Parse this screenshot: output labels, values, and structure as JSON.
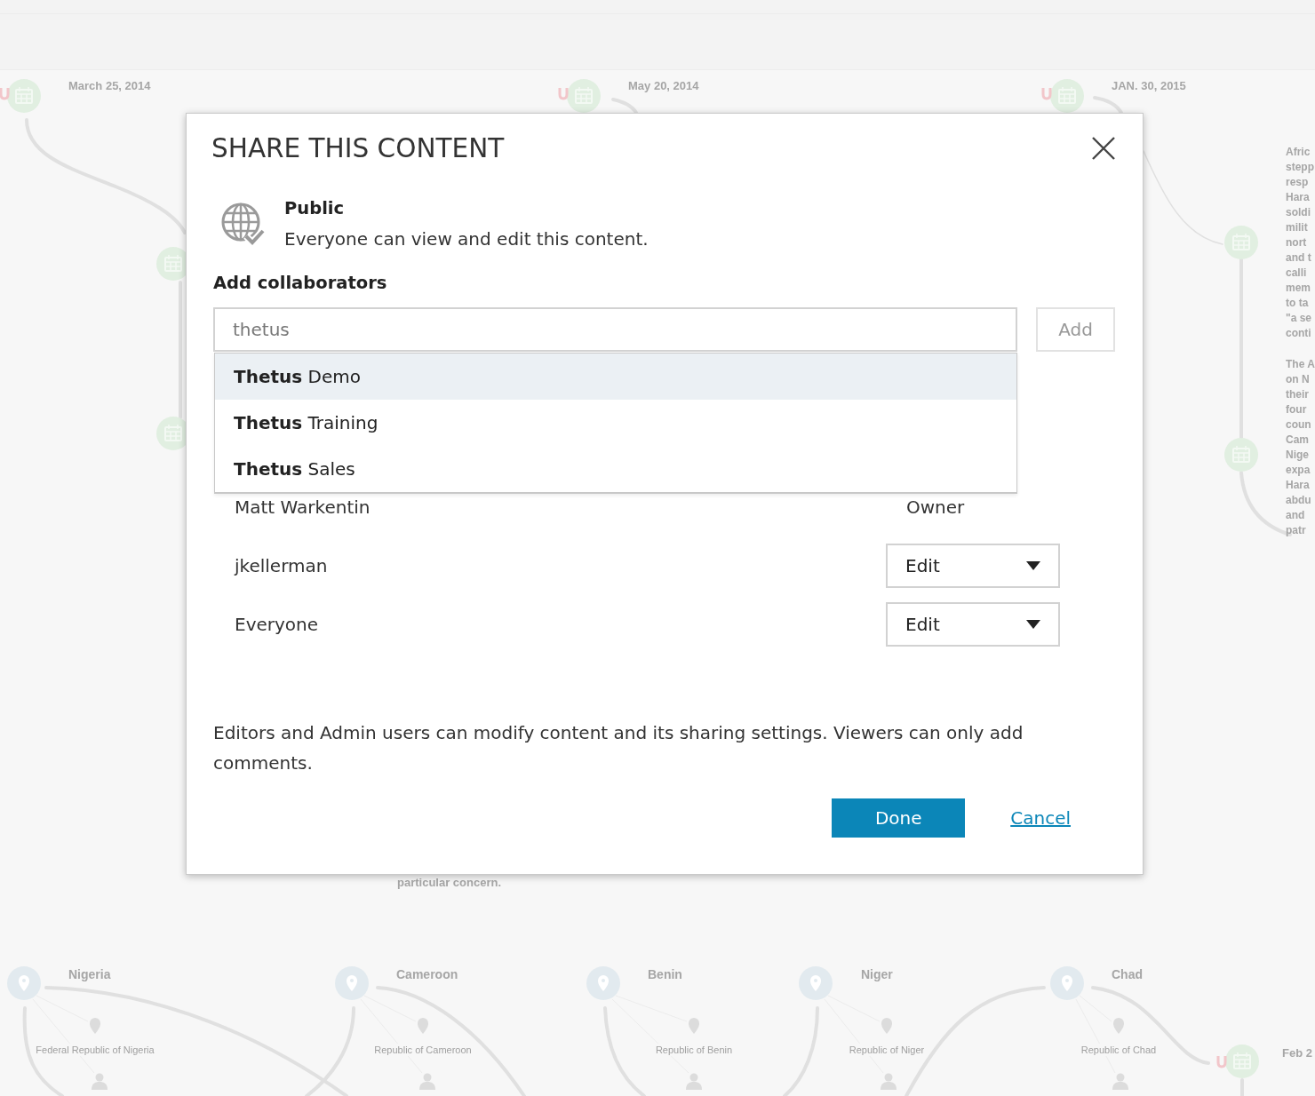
{
  "background": {
    "timeline_dates": [
      "March 25, 2014",
      "May 20, 2014",
      "JAN. 30, 2015",
      "Feb 2"
    ],
    "side_text": [
      [
        "Afric",
        "stepp",
        "resp",
        "Hara",
        "soldi",
        "milit",
        "nort",
        "and t",
        "calli",
        "mem",
        "to ta",
        "\"a se",
        "conti"
      ],
      [
        "The A",
        "on N",
        "their",
        "four",
        "coun",
        "Cam",
        "Nige",
        "expa",
        "Hara",
        "abdu",
        "and",
        "patr"
      ]
    ],
    "caption_fragment": "particular concern.",
    "locations": [
      {
        "name": "Nigeria",
        "detail": "Federal Republic of Nigeria"
      },
      {
        "name": "Cameroon",
        "detail": "Republic of Cameroon"
      },
      {
        "name": "Benin",
        "detail": "Republic of Benin"
      },
      {
        "name": "Niger",
        "detail": "Republic of Niger"
      },
      {
        "name": "Chad",
        "detail": "Republic of Chad"
      }
    ]
  },
  "dialog": {
    "title": "SHARE THIS CONTENT",
    "visibility": {
      "label": "Public",
      "description": "Everyone can view and edit this content."
    },
    "collaborators_heading": "Add collaborators",
    "search": {
      "value": "thetus"
    },
    "add_button": "Add",
    "suggestions": [
      {
        "label": "**Thetus** Demo",
        "selected": true
      },
      {
        "label": "**Thetus** Training",
        "selected": false
      },
      {
        "label": "**Thetus** Sales",
        "selected": false
      }
    ],
    "collaborators": [
      {
        "name": "Matt Warkentin",
        "kind": "fixed",
        "role": "Owner"
      },
      {
        "name": "jkellerman",
        "kind": "select",
        "role": "Edit"
      },
      {
        "name": "Everyone",
        "kind": "select",
        "role": "Edit"
      }
    ],
    "note": "Editors and Admin users can modify content and its sharing settings. Viewers can only add comments.",
    "buttons": {
      "done": "Done",
      "cancel": "Cancel"
    }
  }
}
